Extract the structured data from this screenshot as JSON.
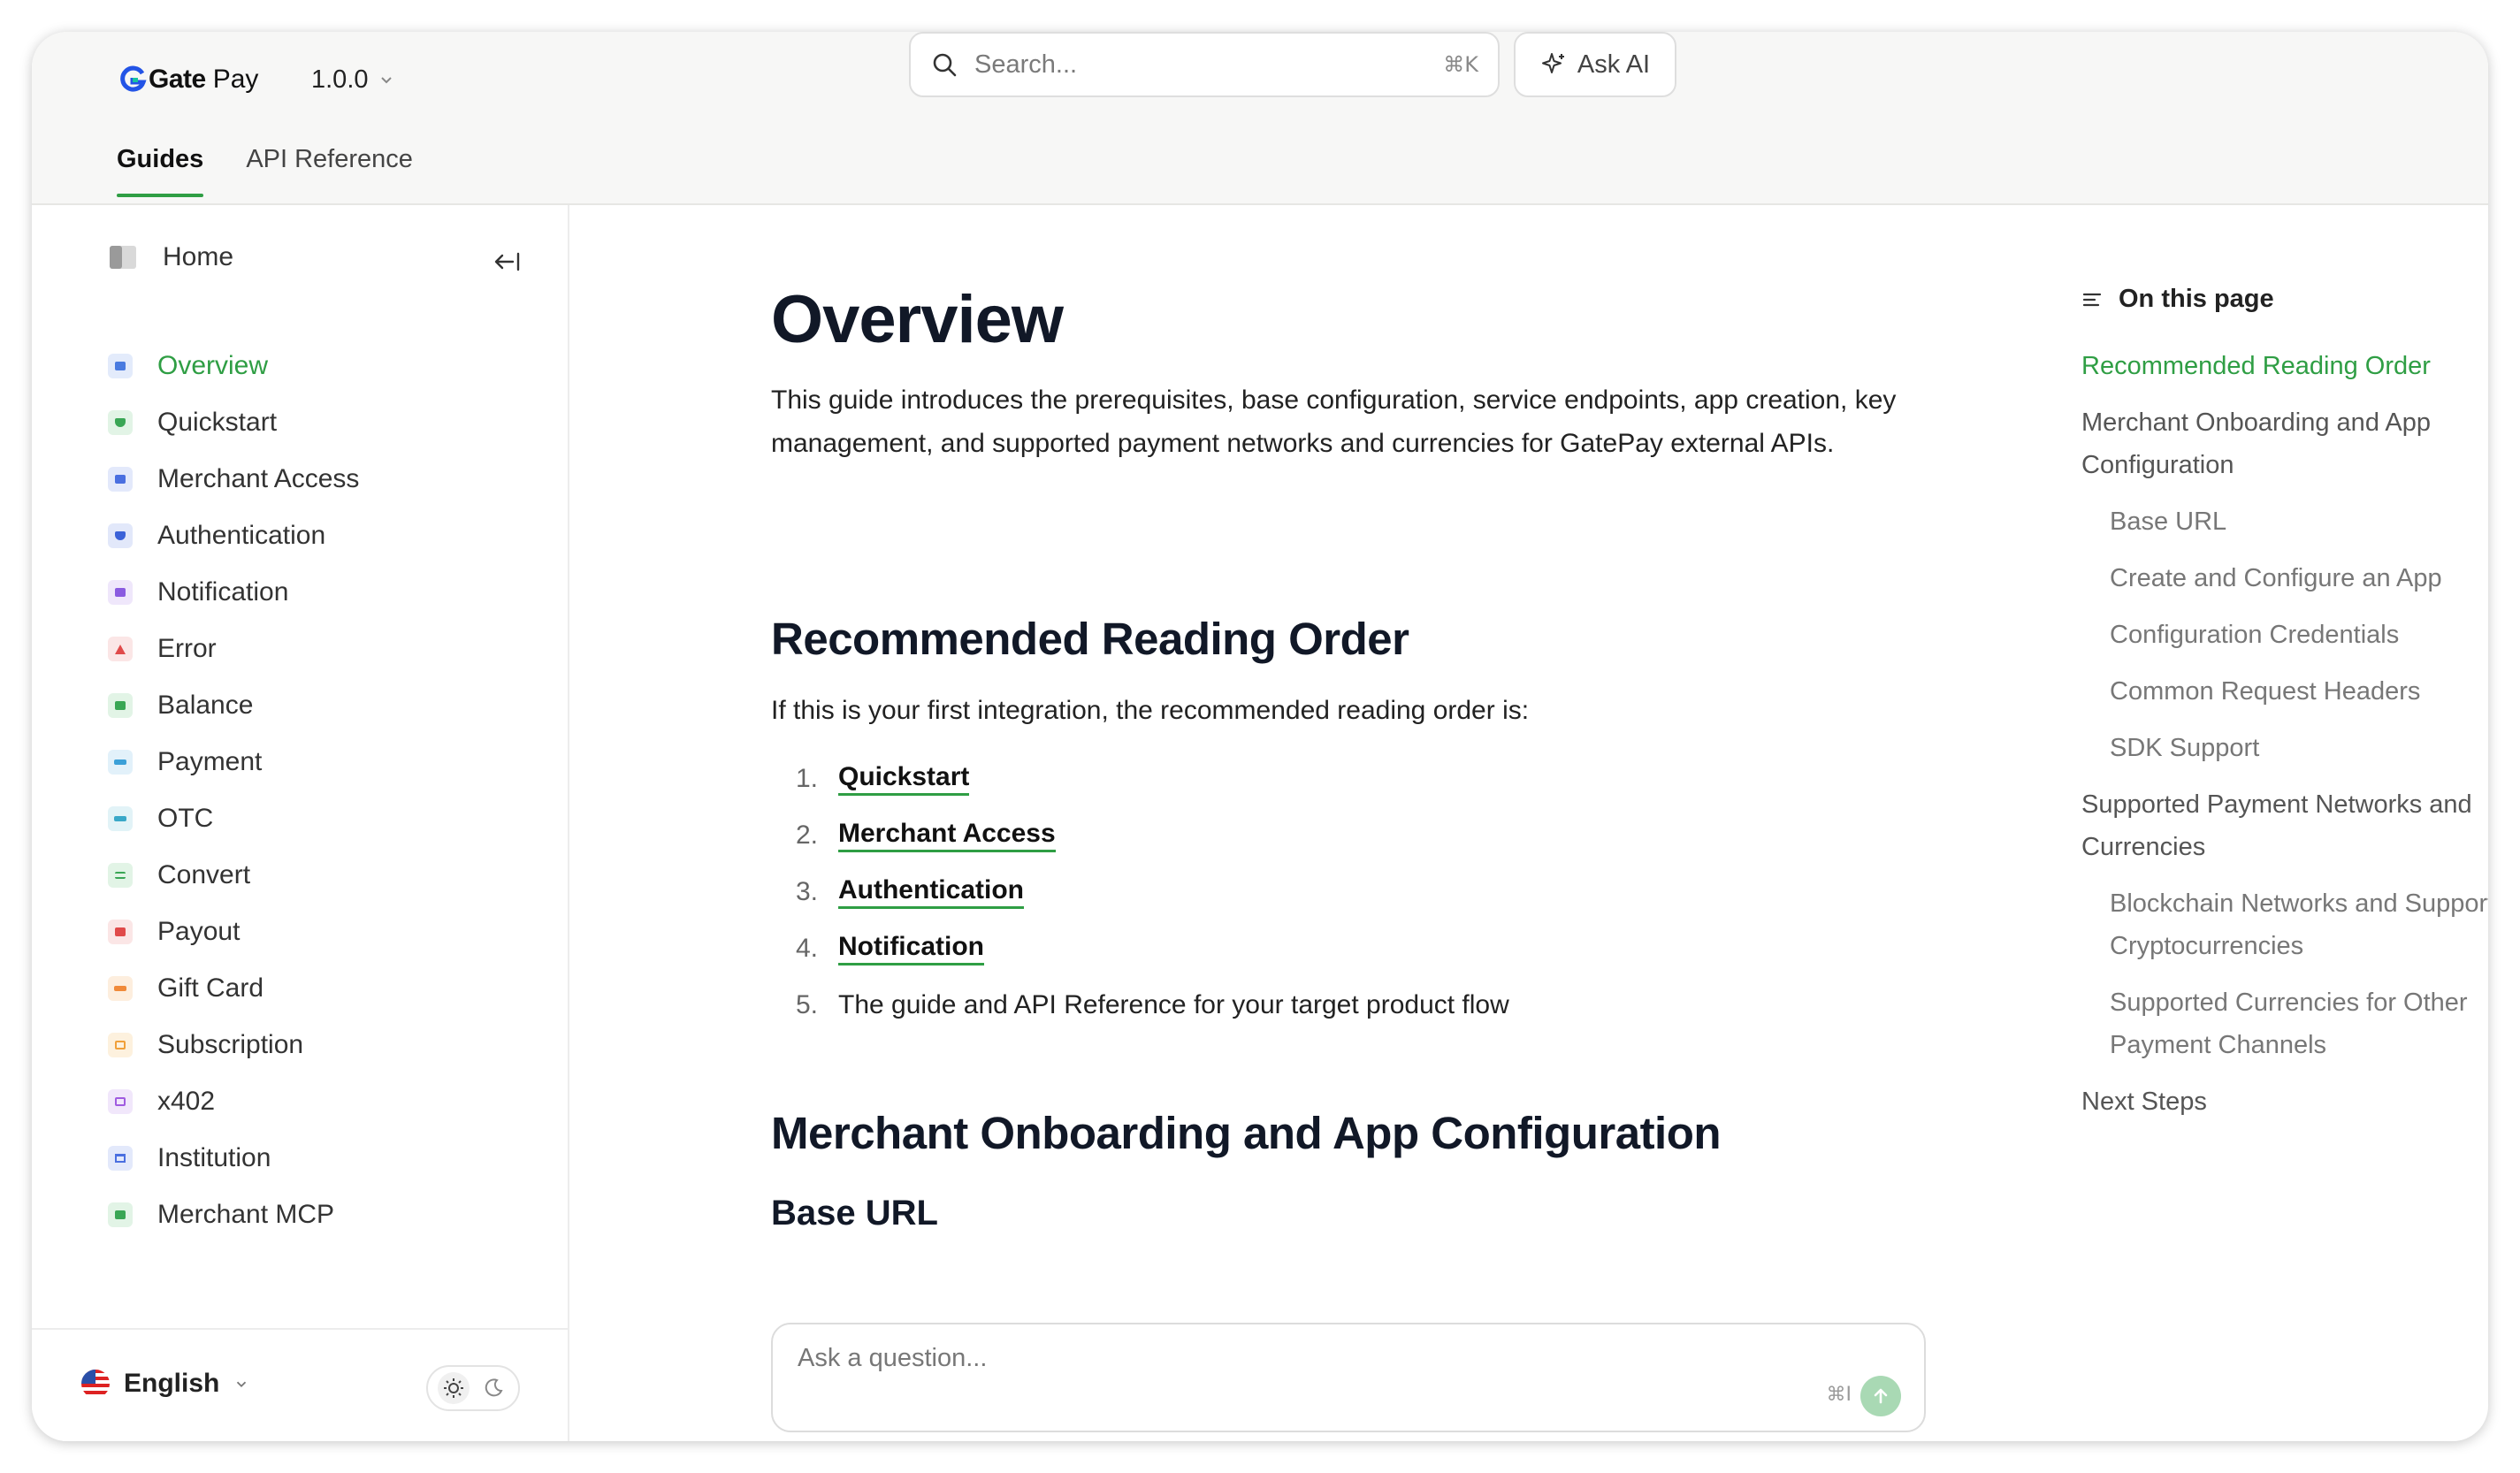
{
  "header": {
    "brand": "Gate",
    "brand_suffix": "Pay",
    "version": "1.0.0",
    "search_placeholder": "Search...",
    "search_shortcut": "⌘K",
    "ask_ai_label": "Ask AI",
    "tabs": [
      {
        "label": "Guides",
        "active": true
      },
      {
        "label": "API Reference",
        "active": false
      }
    ]
  },
  "sidebar": {
    "home_label": "Home",
    "items": [
      {
        "label": "Overview",
        "icon": "overview-icon",
        "color": "#4a7be0",
        "active": true
      },
      {
        "label": "Quickstart",
        "icon": "shield-check-icon",
        "color": "#3aa655"
      },
      {
        "label": "Merchant Access",
        "icon": "merchant-icon",
        "color": "#4a6fe0"
      },
      {
        "label": "Authentication",
        "icon": "shield-icon",
        "color": "#3b62d8"
      },
      {
        "label": "Notification",
        "icon": "chat-icon",
        "color": "#8a5be0"
      },
      {
        "label": "Error",
        "icon": "warning-icon",
        "color": "#e04a4a"
      },
      {
        "label": "Balance",
        "icon": "wallet-icon",
        "color": "#3aa655"
      },
      {
        "label": "Payment",
        "icon": "card-icon",
        "color": "#3ba0d8"
      },
      {
        "label": "OTC",
        "icon": "card-icon",
        "color": "#3aa8c8"
      },
      {
        "label": "Convert",
        "icon": "convert-icon",
        "color": "#3aa655"
      },
      {
        "label": "Payout",
        "icon": "payout-icon",
        "color": "#e04a4a"
      },
      {
        "label": "Gift Card",
        "icon": "gift-icon",
        "color": "#f08a3a"
      },
      {
        "label": "Subscription",
        "icon": "calendar-icon",
        "color": "#f0a03a"
      },
      {
        "label": "x402",
        "icon": "protocol-icon",
        "color": "#a05be0"
      },
      {
        "label": "Institution",
        "icon": "bank-icon",
        "color": "#4a6fe0"
      },
      {
        "label": "Merchant MCP",
        "icon": "mcp-icon",
        "color": "#3aa655"
      }
    ],
    "language": "English"
  },
  "main": {
    "title": "Overview",
    "intro": "This guide introduces the prerequisites, base configuration, service endpoints, app creation, key management, and supported payment networks and currencies for GatePay external APIs.",
    "section1_title": "Recommended Reading Order",
    "section1_text": "If this is your first integration, the recommended reading order is:",
    "reading_order": [
      {
        "num": "1.",
        "label": "Quickstart",
        "link": true
      },
      {
        "num": "2.",
        "label": "Merchant Access",
        "link": true
      },
      {
        "num": "3.",
        "label": "Authentication",
        "link": true
      },
      {
        "num": "4.",
        "label": "Notification",
        "link": true
      },
      {
        "num": "5.",
        "label": "The guide and API Reference for your target product flow",
        "link": false
      }
    ],
    "section2_title": "Merchant Onboarding and App Configuration",
    "section2_sub": "Base URL",
    "ask_placeholder": "Ask a question...",
    "ask_shortcut": "⌘I"
  },
  "toc": {
    "heading": "On this page",
    "items": [
      {
        "label": "Recommended Reading Order",
        "level": 1,
        "active": true
      },
      {
        "label": "Merchant Onboarding and App Configuration",
        "level": 1
      },
      {
        "label": "Base URL",
        "level": 2
      },
      {
        "label": "Create and Configure an App",
        "level": 2
      },
      {
        "label": "Configuration Credentials",
        "level": 2
      },
      {
        "label": "Common Request Headers",
        "level": 2
      },
      {
        "label": "SDK Support",
        "level": 2
      },
      {
        "label": "Supported Payment Networks and Currencies",
        "level": 1
      },
      {
        "label": "Blockchain Networks and Supported Cryptocurrencies",
        "level": 2
      },
      {
        "label": "Supported Currencies for Other Payment Channels",
        "level": 2
      },
      {
        "label": "Next Steps",
        "level": 1
      }
    ]
  },
  "colors": {
    "accent": "#2f9e44",
    "send_button": "#a9d9b4"
  }
}
